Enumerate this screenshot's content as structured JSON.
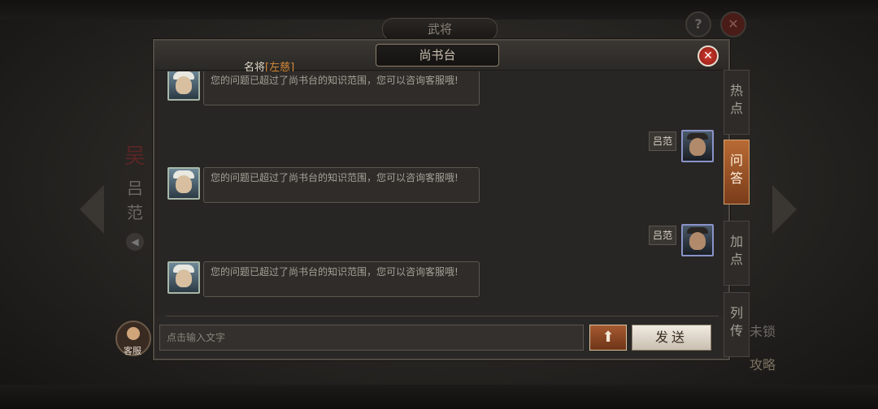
{
  "background": {
    "top_title": "武将",
    "side_hero": {
      "nation": "吴",
      "name": "吕范"
    },
    "unlock_label": "未锁",
    "guide_label": "攻略"
  },
  "panel": {
    "title": "尚书台",
    "breadcrumb": "名将",
    "breadcrumb_tag": "[左慈]"
  },
  "messages": [
    {
      "from": "bot",
      "text": "您的问题已超过了尚书台的知识范围，您可以咨询客服哦!"
    },
    {
      "from": "user",
      "name": "吕范"
    },
    {
      "from": "bot",
      "text": "您的问题已超过了尚书台的知识范围，您可以咨询客服哦!"
    },
    {
      "from": "user",
      "name": "吕范"
    },
    {
      "from": "bot",
      "text": "您的问题已超过了尚书台的知识范围，您可以咨询客服哦!"
    }
  ],
  "input": {
    "placeholder": "点击输入文字"
  },
  "buttons": {
    "send": "发送",
    "up": "⬆",
    "support": "客服",
    "help": "?",
    "close": "✕"
  },
  "tabs": [
    {
      "label": "热点",
      "active": false
    },
    {
      "label": "问答",
      "active": true
    },
    {
      "label": "加点",
      "active": false
    },
    {
      "label": "列传",
      "active": false
    }
  ],
  "colors": {
    "accent": "#b86a34",
    "close": "#d23a2e"
  }
}
